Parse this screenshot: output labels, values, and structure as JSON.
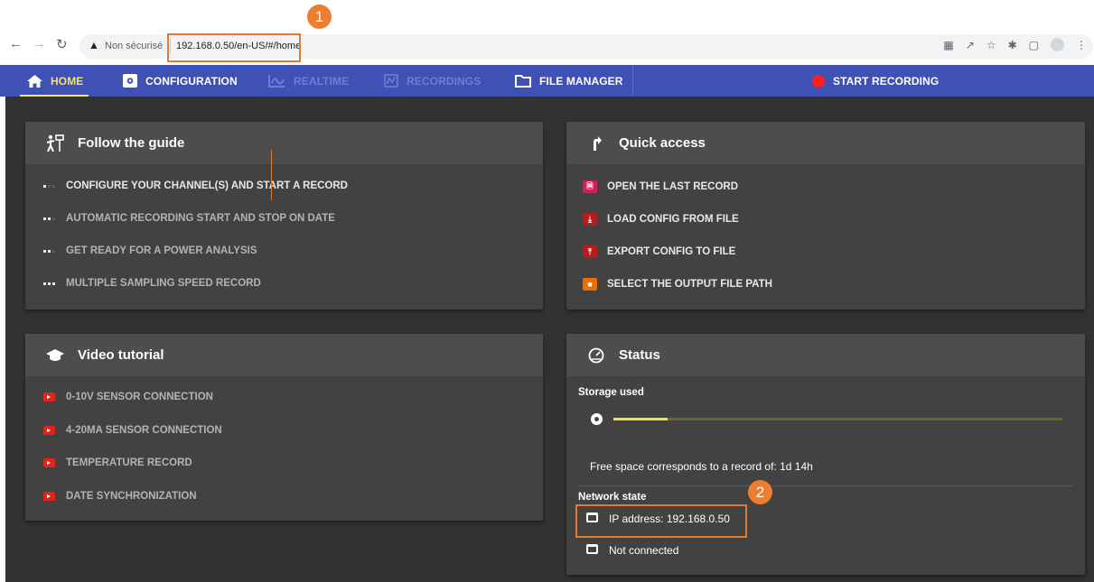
{
  "browser": {
    "not_secure_label": "Non sécurisé",
    "url": "192.168.0.50/en-US/#/home",
    "back_icon": "arrow-left-icon",
    "forward_icon": "arrow-right-icon",
    "reload_icon": "reload-icon"
  },
  "annotations": {
    "badge_1": "1",
    "badge_2": "2",
    "highlight_color": "#ed7d31"
  },
  "nav": {
    "home": "HOME",
    "configuration": "CONFIGURATION",
    "realtime": "REALTIME",
    "recordings": "RECORDINGS",
    "file_manager": "FILE MANAGER",
    "start_recording": "START RECORDING",
    "bar_color": "#3f51b5",
    "active_color": "#f5e663"
  },
  "guide": {
    "title": "Follow the guide",
    "items": [
      "CONFIGURE YOUR CHANNEL(S) AND START A RECORD",
      "AUTOMATIC RECORDING START AND STOP ON DATE",
      "GET READY FOR A POWER ANALYSIS",
      "MULTIPLE SAMPLING SPEED RECORD"
    ]
  },
  "quick_access": {
    "title": "Quick access",
    "items": [
      "OPEN THE LAST RECORD",
      "LOAD CONFIG FROM FILE",
      "EXPORT CONFIG TO FILE",
      "SELECT THE OUTPUT FILE PATH"
    ]
  },
  "video": {
    "title": "Video tutorial",
    "items": [
      "0-10V SENSOR CONNECTION",
      "4-20MA SENSOR CONNECTION",
      "TEMPERATURE RECORD",
      "DATE SYNCHRONIZATION"
    ]
  },
  "status": {
    "title": "Status",
    "storage_label": "Storage used",
    "storage_used_fraction": 0.12,
    "free_space_text": "Free space corresponds to a record of: 1d 14h",
    "network_label": "Network state",
    "ip_text": "IP address: 192.168.0.50",
    "connection_text": "Not connected"
  }
}
